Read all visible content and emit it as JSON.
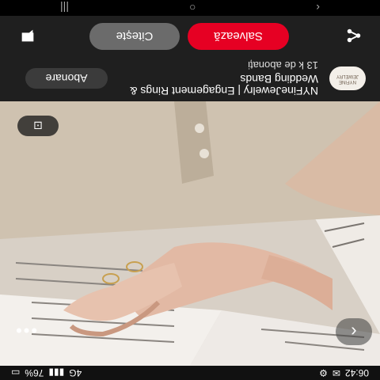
{
  "status_bar": {
    "time": "06:42",
    "battery": "76%",
    "network": "4G"
  },
  "photo": {
    "alt": "Hand with gold rings resting on open book",
    "text_lines": []
  },
  "buttons": {
    "back": "‹",
    "more": "•••",
    "lens": "⊡"
  },
  "info": {
    "avatar_text": "NYFINE JEWELRY",
    "brand": "NYFineJewelry | Engagement Rings & Wedding Bands",
    "followers": "13 k de abonați",
    "follow_label": "Abonare"
  },
  "actions": {
    "save_label": "Salvează",
    "read_label": "Citește"
  },
  "nav": {
    "back": "‹",
    "home": "○",
    "recents": "|||"
  },
  "colors": {
    "accent_save": "#e60023",
    "bar_bg": "#1f1f1f"
  }
}
